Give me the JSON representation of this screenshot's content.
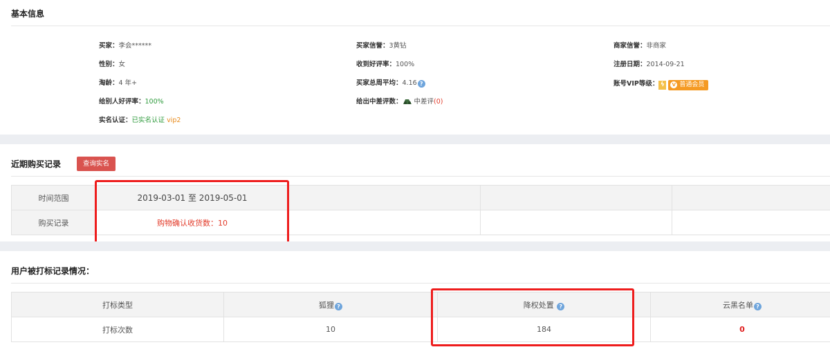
{
  "basic": {
    "title": "基本信息",
    "buyer_label": "买家：",
    "buyer_value": "李会******",
    "gender_label": "性别：",
    "gender_value": "女",
    "taoling_label": "淘龄：",
    "taoling_value": "4 年+",
    "give_rate_label": "给别人好评率：",
    "give_rate_value": "100%",
    "realname_label": "实名认证：",
    "realname_value": "已实名认证",
    "realname_vip": "vip2",
    "buyer_credit_label": "买家信誉：",
    "buyer_credit_value": "3黄钻",
    "recv_rate_label": "收到好评率：",
    "recv_rate_value": "100%",
    "week_avg_label": "买家总周平均：",
    "week_avg_value": "4.16",
    "mid_bad_label": "给出中差评数：",
    "mid_bad_text": "中差评",
    "mid_bad_count": "(0)",
    "seller_credit_label": "商家信誉：",
    "seller_credit_value": "非商家",
    "reg_date_label": "注册日期：",
    "reg_date_value": "2014-09-21",
    "vip_level_label": "账号VIP等级：",
    "vip_member_text": "普通会员",
    "help_icon": "?"
  },
  "recent": {
    "title": "近期购买记录",
    "query_button": "查询实名",
    "time_range_label": "时间范围",
    "time_range_value": "2019-03-01 至 2019-05-01",
    "purchase_label": "购买记录",
    "purchase_value": "购物确认收货数：10"
  },
  "marks": {
    "title": "用户被打标记录情况：",
    "type_label": "打标类型",
    "count_label": "打标次数",
    "col_fox": "狐狸",
    "col_down": "降权处置",
    "col_cloud": "云黑名单",
    "val_fox": "10",
    "val_down": "184",
    "val_cloud": "0"
  },
  "colors": {
    "accent_red": "#d9534f",
    "highlight_box": "#ee1c1c",
    "verified_green": "#2e9a3c",
    "vip_orange": "#f59a23",
    "help_blue": "#6fa5dc"
  },
  "icons": [
    "help-icon",
    "vip-lightning-icon",
    "vip-member-icon",
    "rating-face-icon"
  ]
}
